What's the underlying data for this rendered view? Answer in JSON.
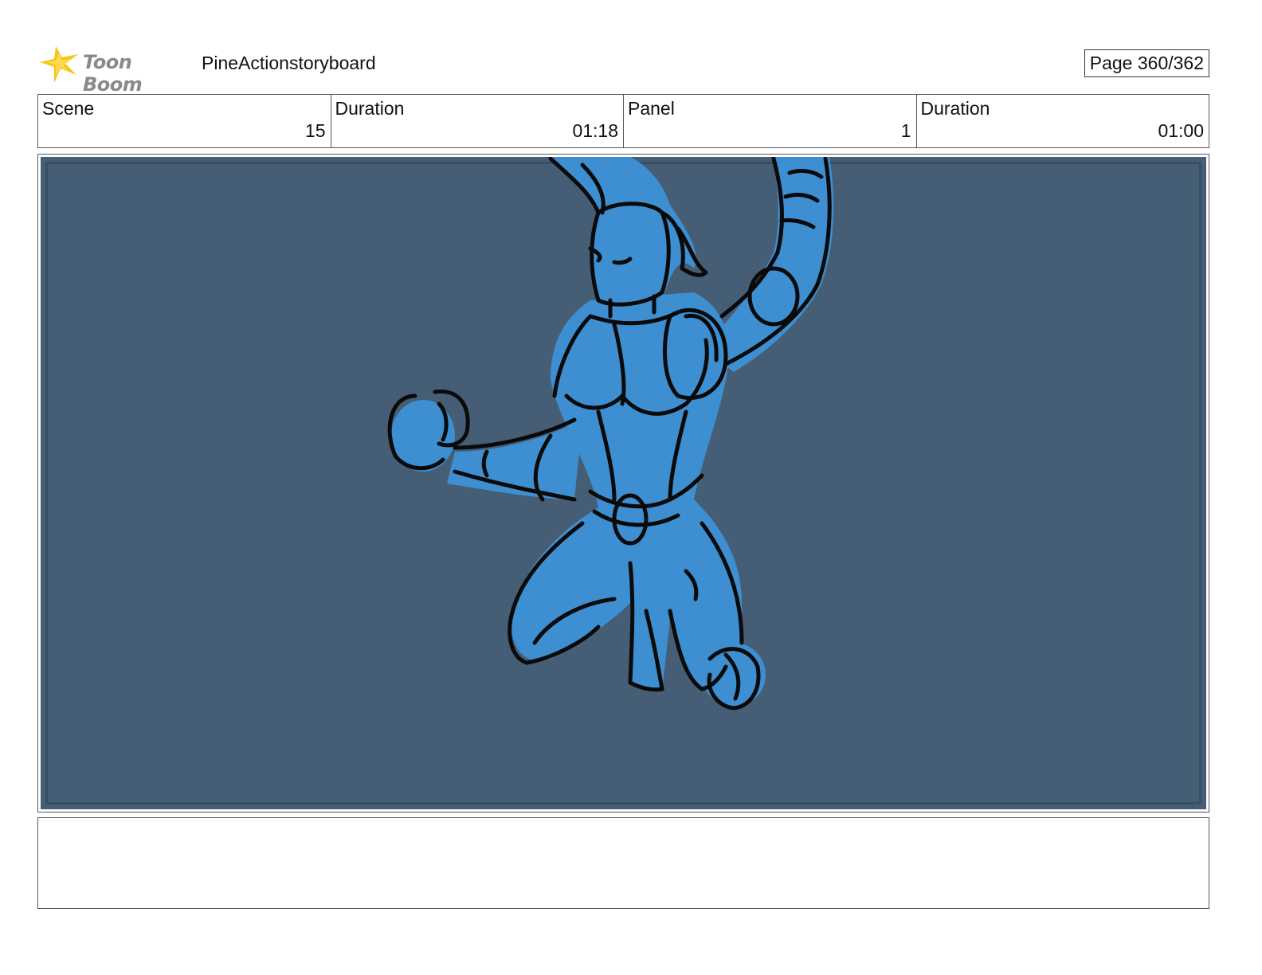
{
  "header": {
    "logo_text": "Toon Boom",
    "project_title": "PineActionstoryboard",
    "page_label": "Page 360/362"
  },
  "info": {
    "scene_label": "Scene",
    "scene_value": "15",
    "scene_duration_label": "Duration",
    "scene_duration_value": "01:18",
    "panel_label": "Panel",
    "panel_value": "1",
    "panel_duration_label": "Duration",
    "panel_duration_value": "01:00"
  },
  "notes": {
    "text": ""
  },
  "colors": {
    "panel_background": "#465e75",
    "figure_fill": "#3d8fd2",
    "sketch_line": "#0a0a0a",
    "logo_star": "#f5c518"
  }
}
